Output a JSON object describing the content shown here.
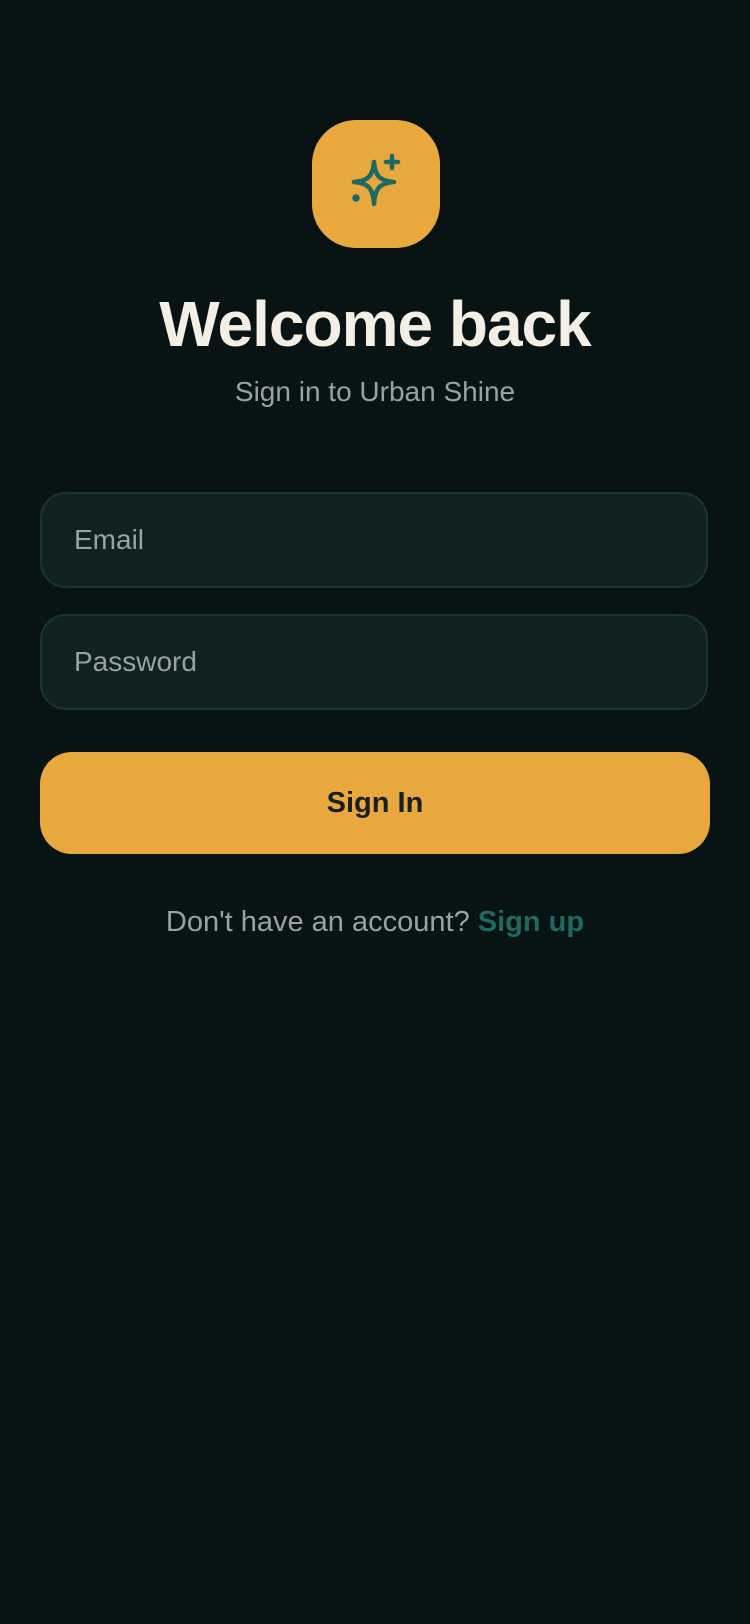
{
  "colors": {
    "background": "#081313",
    "accent": "#E8A83E",
    "icon": "#1E6A63",
    "field_background": "#0F2120",
    "field_border": "#1D3331",
    "title": "#F3EFE4",
    "muted": "#98A3A0",
    "link": "#1E6A63"
  },
  "logo": {
    "icon": "sparkle-icon"
  },
  "header": {
    "title": "Welcome back",
    "subtitle": "Sign in to Urban Shine"
  },
  "form": {
    "email": {
      "placeholder": "Email",
      "value": ""
    },
    "password": {
      "placeholder": "Password",
      "value": ""
    },
    "submit_label": "Sign In"
  },
  "footer": {
    "prompt": "Don't have an account?",
    "link_label": "Sign up"
  }
}
